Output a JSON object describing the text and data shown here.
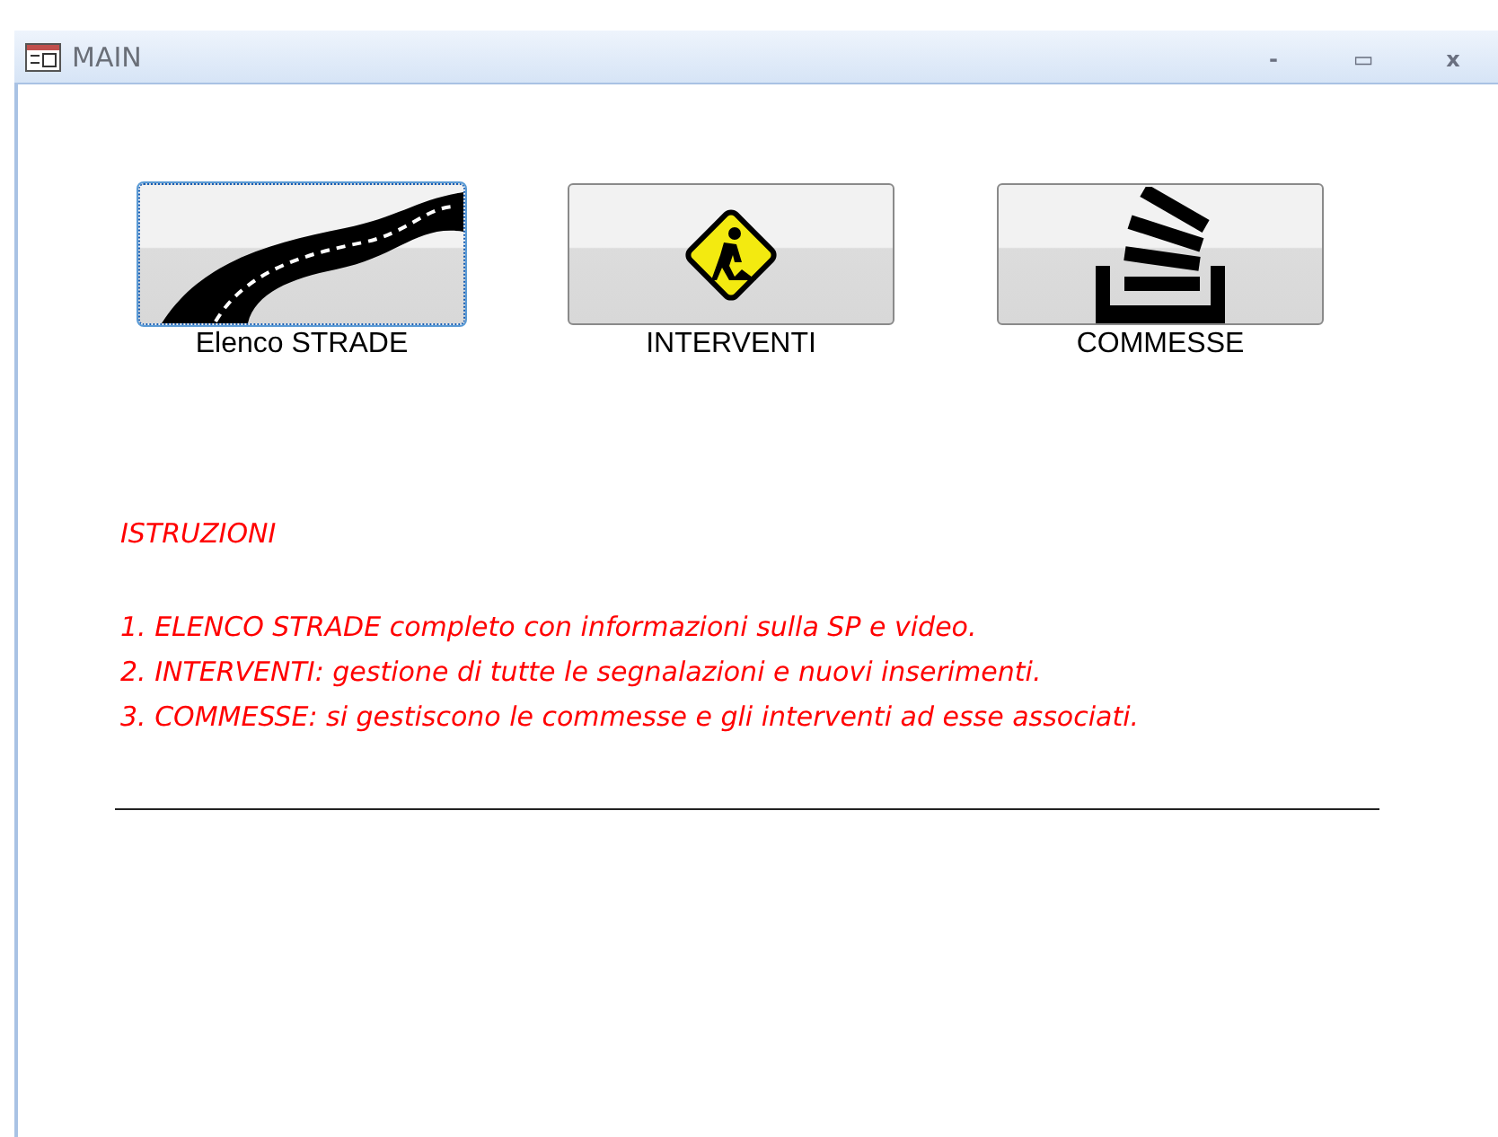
{
  "window": {
    "title": "MAIN",
    "controls": [
      "-",
      "▭",
      "x"
    ]
  },
  "buttons": [
    {
      "kind": "road",
      "label": "Elenco STRADE",
      "focused": true
    },
    {
      "kind": "worker",
      "label": "INTERVENTI",
      "focused": false
    },
    {
      "kind": "stack",
      "label": "COMMESSE",
      "focused": false
    }
  ],
  "instructions": {
    "heading": "ISTRUZIONI",
    "lines": [
      "1. ELENCO STRADE completo con informazioni sulla SP e video.",
      "2. INTERVENTI: gestione di tutte le segnalazioni e nuovi inserimenti.",
      "3. COMMESSE: si gestiscono le commesse e gli interventi ad esse associati."
    ]
  }
}
